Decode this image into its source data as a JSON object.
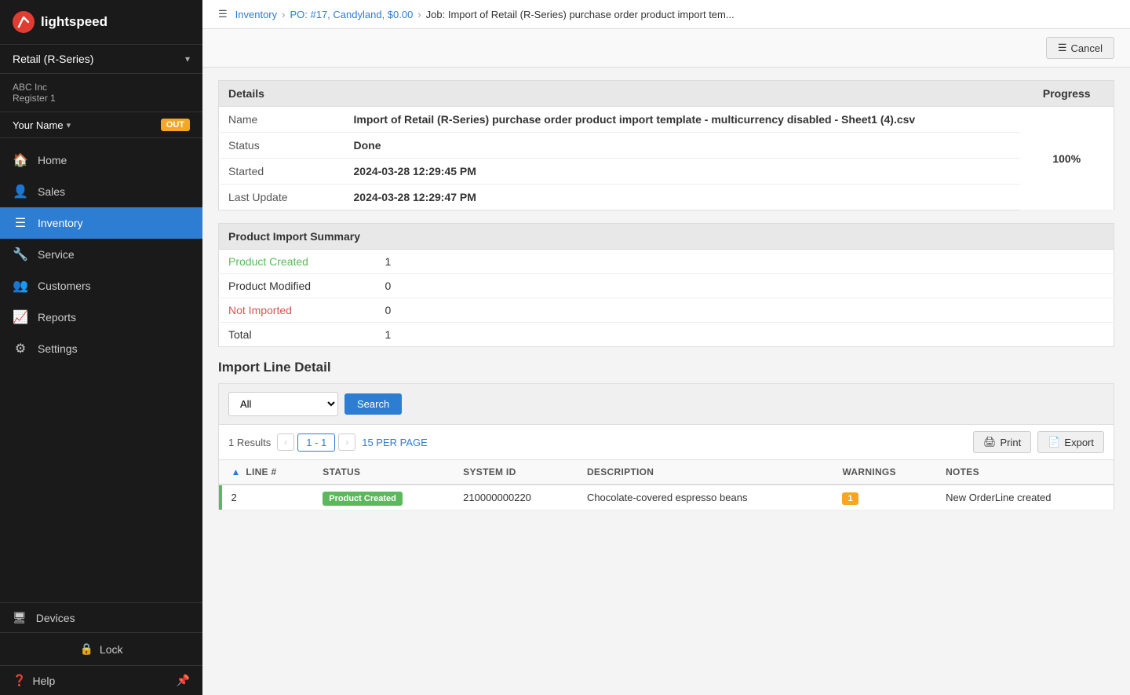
{
  "sidebar": {
    "logo_text": "lightspeed",
    "store_selector": {
      "label": "Retail (R-Series)",
      "caret": "▾"
    },
    "account": {
      "company": "ABC Inc",
      "register": "Register 1"
    },
    "user": {
      "name": "Your Name",
      "caret": "▾",
      "out_badge": "OUT"
    },
    "nav_items": [
      {
        "id": "home",
        "icon": "🏠",
        "label": "Home",
        "active": false
      },
      {
        "id": "sales",
        "icon": "👤",
        "label": "Sales",
        "active": false
      },
      {
        "id": "inventory",
        "icon": "☰",
        "label": "Inventory",
        "active": true
      },
      {
        "id": "service",
        "icon": "🔧",
        "label": "Service",
        "active": false
      },
      {
        "id": "customers",
        "icon": "👥",
        "label": "Customers",
        "active": false
      },
      {
        "id": "reports",
        "icon": "📈",
        "label": "Reports",
        "active": false
      },
      {
        "id": "settings",
        "icon": "⚙",
        "label": "Settings",
        "active": false
      }
    ],
    "devices": {
      "label": "Devices",
      "icon": "🖥"
    },
    "lock": {
      "label": "Lock",
      "icon": "🔒"
    },
    "help": {
      "label": "Help",
      "icon": "❓",
      "pin_icon": "📌"
    }
  },
  "breadcrumb": {
    "icon": "☰",
    "steps": [
      {
        "label": "Inventory",
        "link": true
      },
      {
        "label": "PO: #17, Candyland, $0.00",
        "link": true
      },
      {
        "label": "Job: Import of Retail (R-Series) purchase order product import tem...",
        "link": false
      }
    ]
  },
  "action_bar": {
    "cancel_label": "Cancel",
    "cancel_icon": "☰"
  },
  "details": {
    "section_title": "Details",
    "progress_title": "Progress",
    "rows": [
      {
        "label": "Name",
        "value": "Import of Retail (R-Series) purchase order product import template - multicurrency disabled - Sheet1 (4).csv",
        "bold": true
      },
      {
        "label": "Status",
        "value": "Done",
        "bold": true
      },
      {
        "label": "Started",
        "value": "2024-03-28 12:29:45 PM",
        "bold": true
      },
      {
        "label": "Last Update",
        "value": "2024-03-28 12:29:47 PM",
        "bold": true
      }
    ],
    "progress_value": "100%"
  },
  "summary": {
    "section_title": "Product Import Summary",
    "rows": [
      {
        "label": "Product Created",
        "value": "1",
        "style": "green"
      },
      {
        "label": "Product Modified",
        "value": "0",
        "style": "normal"
      },
      {
        "label": "Not Imported",
        "value": "0",
        "style": "red"
      },
      {
        "label": "Total",
        "value": "1",
        "style": "normal"
      }
    ]
  },
  "import_line": {
    "title": "Import Line Detail",
    "filter": {
      "select_options": [
        "All",
        "Product Created",
        "Product Modified",
        "Not Imported"
      ],
      "select_value": "All",
      "search_label": "Search"
    },
    "results": {
      "count": "1 Results",
      "prev_disabled": true,
      "page_range": "1 - 1",
      "next_disabled": true,
      "per_page": "15 PER PAGE",
      "print_label": "Print",
      "export_label": "Export"
    },
    "columns": [
      {
        "key": "line_num",
        "label": "LINE #",
        "sortable": true,
        "sort_arrow": "▲"
      },
      {
        "key": "status",
        "label": "STATUS",
        "sortable": false
      },
      {
        "key": "system_id",
        "label": "SYSTEM ID",
        "sortable": false
      },
      {
        "key": "description",
        "label": "DESCRIPTION",
        "sortable": false
      },
      {
        "key": "warnings",
        "label": "WARNINGS",
        "sortable": false
      },
      {
        "key": "notes",
        "label": "NOTES",
        "sortable": false
      }
    ],
    "rows": [
      {
        "indicator_color": "#5cb85c",
        "line_num": "2",
        "status_badge": "Product Created",
        "status_badge_style": "product-created",
        "system_id": "210000000220",
        "description": "Chocolate-covered espresso beans",
        "warnings": "1",
        "notes": "New OrderLine created"
      }
    ]
  }
}
